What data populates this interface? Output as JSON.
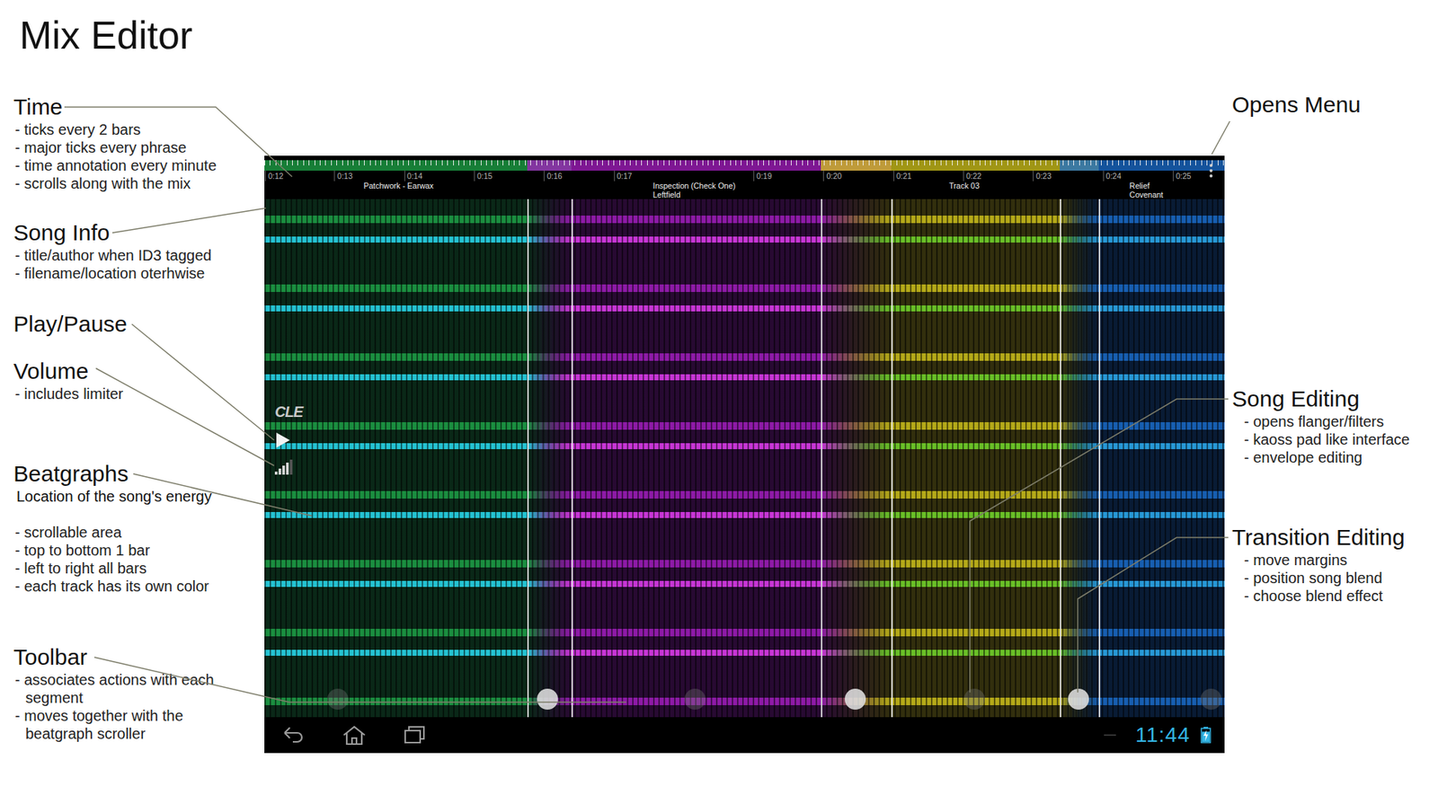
{
  "title": "Mix Editor",
  "annotations_left": [
    {
      "heading": "Time",
      "bullets": [
        "- ticks every 2 bars",
        "- major ticks every phrase",
        "- time annotation every minute",
        "- scrolls along with the mix"
      ]
    },
    {
      "heading": "Song Info",
      "bullets": [
        "- title/author when ID3 tagged",
        "- filename/location oterhwise"
      ]
    },
    {
      "heading": "Play/Pause",
      "bullets": []
    },
    {
      "heading": "Volume",
      "bullets": [
        "- includes limiter"
      ]
    },
    {
      "heading": "Beatgraphs",
      "subtitle": "Location of the song's energy",
      "bullets": [
        "- scrollable area",
        "- top to bottom 1 bar",
        "- left to right all bars",
        "- each track has its own color"
      ]
    },
    {
      "heading": "Toolbar",
      "bullets": [
        "- associates actions with each segment",
        "- moves together with the beatgraph scroller"
      ]
    }
  ],
  "annotations_right": [
    {
      "heading": "Opens Menu",
      "bullets": []
    },
    {
      "heading": "Song Editing",
      "bullets": [
        "- opens flanger/filters",
        "- kaoss pad like interface",
        "- envelope editing"
      ]
    },
    {
      "heading": "Transition Editing",
      "bullets": [
        "- move margins",
        "- position song blend",
        "- choose blend effect"
      ]
    }
  ],
  "screen": {
    "timeline": {
      "ticks": [
        {
          "label": "0:12",
          "at": 12
        },
        {
          "label": "0:13",
          "at": 13
        },
        {
          "label": "0:14",
          "at": 14
        },
        {
          "label": "0:15",
          "at": 15
        },
        {
          "label": "0:16",
          "at": 16
        },
        {
          "label": "0:17",
          "at": 17
        },
        {
          "label": "0:19",
          "at": 19
        },
        {
          "label": "0:20",
          "at": 20
        },
        {
          "label": "0:21",
          "at": 21
        },
        {
          "label": "0:22",
          "at": 22
        },
        {
          "label": "0:23",
          "at": 23
        },
        {
          "label": "0:24",
          "at": 24
        },
        {
          "label": "0:25",
          "at": 25
        }
      ]
    },
    "tracks": [
      {
        "lines": [
          "Patchwork - Earwax"
        ],
        "label_at": 13.42,
        "start": 12,
        "end": 16.39,
        "color": "#1fa84a",
        "accent": "#27d3e6"
      },
      {
        "lines": [
          "Inspection (Check One)",
          "Leftfield"
        ],
        "label_at": 17.56,
        "start": 15.76,
        "end": 20.97,
        "color": "#a81fc4",
        "accent": "#d83ae8"
      },
      {
        "lines": [
          "Track 03"
        ],
        "label_at": 21.8,
        "start": 19.96,
        "end": 23.94,
        "color": "#d6c81c",
        "accent": "#6fcf2a"
      },
      {
        "lines": [
          "Relief",
          "Covenant"
        ],
        "label_at": 24.38,
        "start": 23.38,
        "end": 25.74,
        "color": "#1b6fd0",
        "accent": "#2aa6e8"
      }
    ],
    "transitions": [
      {
        "start": 15.76,
        "end": 16.39
      },
      {
        "start": 19.96,
        "end": 20.97
      },
      {
        "start": 23.38,
        "end": 23.94
      }
    ],
    "toolbar": [
      {
        "at": 13.05,
        "selected": false
      },
      {
        "at": 16.05,
        "selected": true
      },
      {
        "at": 18.16,
        "selected": false
      },
      {
        "at": 20.46,
        "selected": true
      },
      {
        "at": 22.16,
        "selected": false
      },
      {
        "at": 23.65,
        "selected": true
      },
      {
        "at": 25.55,
        "selected": false
      }
    ],
    "player": {
      "logo": "CLE",
      "playing": false,
      "volume": 0.8
    },
    "nav": {
      "time": "11:44",
      "battery": {
        "level": 0.8,
        "charging": true
      }
    }
  }
}
